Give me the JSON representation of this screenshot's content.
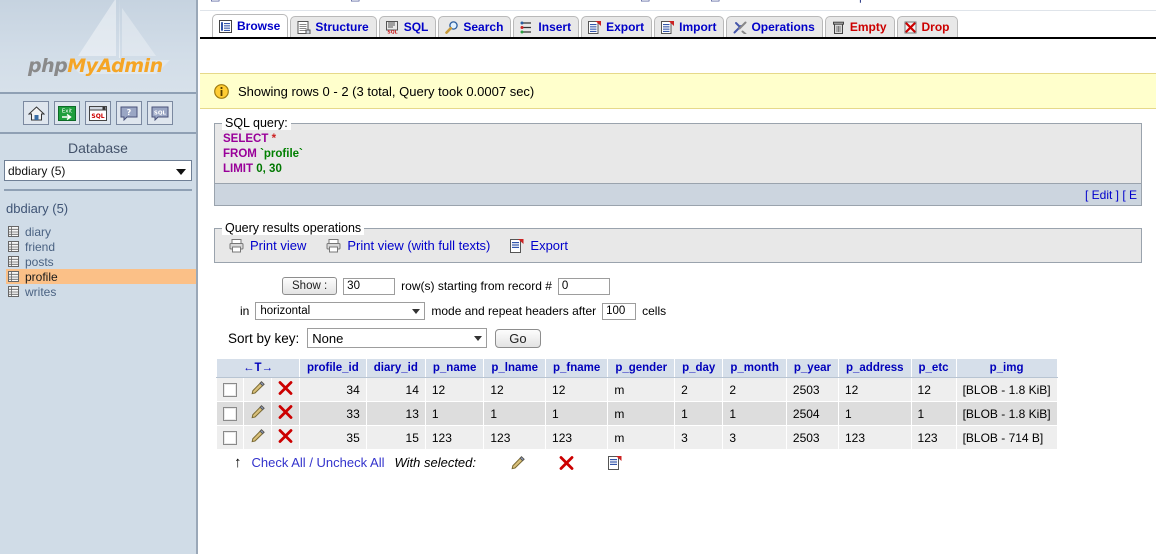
{
  "sidebar": {
    "logo": {
      "php": "php",
      "my": "My",
      "admin": "Admin"
    },
    "nav_icons": [
      {
        "name": "home-icon",
        "title": "Home"
      },
      {
        "name": "exit-icon",
        "title": "Log out"
      },
      {
        "name": "sql-window-icon",
        "title": "Query window"
      },
      {
        "name": "help-icon",
        "title": "phpMyAdmin documentation"
      },
      {
        "name": "sql-help-icon",
        "title": "MySQL documentation"
      }
    ],
    "database_label": "Database",
    "database_select": "dbdiary (5)",
    "db_title": "dbdiary (5)",
    "tables": [
      {
        "name": "diary",
        "active": false
      },
      {
        "name": "friend",
        "active": false
      },
      {
        "name": "posts",
        "active": false
      },
      {
        "name": "profile",
        "active": true
      },
      {
        "name": "writes",
        "active": false
      }
    ]
  },
  "tabs": [
    {
      "label": "Browse",
      "icon": "browse-icon",
      "active": true,
      "danger": false
    },
    {
      "label": "Structure",
      "icon": "structure-icon",
      "active": false,
      "danger": false
    },
    {
      "label": "SQL",
      "icon": "sql-icon",
      "active": false,
      "danger": false
    },
    {
      "label": "Search",
      "icon": "search-icon",
      "active": false,
      "danger": false
    },
    {
      "label": "Insert",
      "icon": "insert-icon",
      "active": false,
      "danger": false
    },
    {
      "label": "Export",
      "icon": "export-icon",
      "active": false,
      "danger": false
    },
    {
      "label": "Import",
      "icon": "import-icon",
      "active": false,
      "danger": false
    },
    {
      "label": "Operations",
      "icon": "operations-icon",
      "active": false,
      "danger": false
    },
    {
      "label": "Empty",
      "icon": "empty-icon",
      "active": false,
      "danger": true
    },
    {
      "label": "Drop",
      "icon": "drop-icon",
      "active": false,
      "danger": true
    }
  ],
  "info": {
    "message": "Showing rows 0 - 2 (3 total, Query took 0.0007 sec)"
  },
  "sql_query": {
    "legend": "SQL query:",
    "lines": [
      {
        "kw": "SELECT",
        "rest_star": "*"
      },
      {
        "kw": "FROM",
        "ident": "`profile`"
      },
      {
        "kw": "LIMIT",
        "a": "0",
        "comma": ",",
        "b": "30"
      }
    ],
    "footer_links": "[ Edit ] [ E"
  },
  "query_results_operations": {
    "legend": "Query results operations",
    "links": [
      {
        "label": "Print view",
        "icon": "print-icon"
      },
      {
        "label": "Print view (with full texts)",
        "icon": "print-icon"
      },
      {
        "label": "Export",
        "icon": "export-icon"
      }
    ]
  },
  "controls": {
    "show_button": "Show :",
    "rows_value": "30",
    "rows_label": "row(s) starting from record #",
    "record_value": "0",
    "in_label": "in",
    "mode_value": "horizontal",
    "mode_label": "mode and repeat headers after",
    "headers_value": "100",
    "cells_label": "cells",
    "sort_label": "Sort by key:",
    "sort_value": "None",
    "go_button": "Go"
  },
  "results_table": {
    "sort_header": "←T→",
    "columns": [
      "profile_id",
      "diary_id",
      "p_name",
      "p_lname",
      "p_fname",
      "p_gender",
      "p_day",
      "p_month",
      "p_year",
      "p_address",
      "p_etc",
      "p_img"
    ],
    "rows": [
      {
        "profile_id": "34",
        "diary_id": "14",
        "p_name": "12",
        "p_lname": "12",
        "p_fname": "12",
        "p_gender": "m",
        "p_day": "2",
        "p_month": "2",
        "p_year": "2503",
        "p_address": "12",
        "p_etc": "12",
        "p_img": "[BLOB - 1.8 KiB]"
      },
      {
        "profile_id": "33",
        "diary_id": "13",
        "p_name": "1",
        "p_lname": "1",
        "p_fname": "1",
        "p_gender": "m",
        "p_day": "1",
        "p_month": "1",
        "p_year": "2504",
        "p_address": "1",
        "p_etc": "1",
        "p_img": "[BLOB - 1.8 KiB]"
      },
      {
        "profile_id": "35",
        "diary_id": "15",
        "p_name": "123",
        "p_lname": "123",
        "p_fname": "123",
        "p_gender": "m",
        "p_day": "3",
        "p_month": "3",
        "p_year": "2503",
        "p_address": "123",
        "p_etc": "123",
        "p_img": "[BLOB - 714 B]"
      }
    ]
  },
  "bottom_bar": {
    "check_all": "Check All",
    "separator": " / ",
    "uncheck_all": "Uncheck All",
    "with_selected": "With selected:",
    "icons": [
      "edit-pencil-icon",
      "delete-x-icon",
      "export-icon"
    ]
  },
  "colors": {
    "sidebar_bg": "#d0dce7",
    "accent_orange": "#f5a525",
    "active_table": "#fbc087",
    "info_bg": "#ffffcc",
    "link": "#0000cc",
    "danger": "#cc0000",
    "header_bg": "#d6dfea",
    "row_odd": "#eeeeee",
    "row_even": "#dddddd"
  }
}
